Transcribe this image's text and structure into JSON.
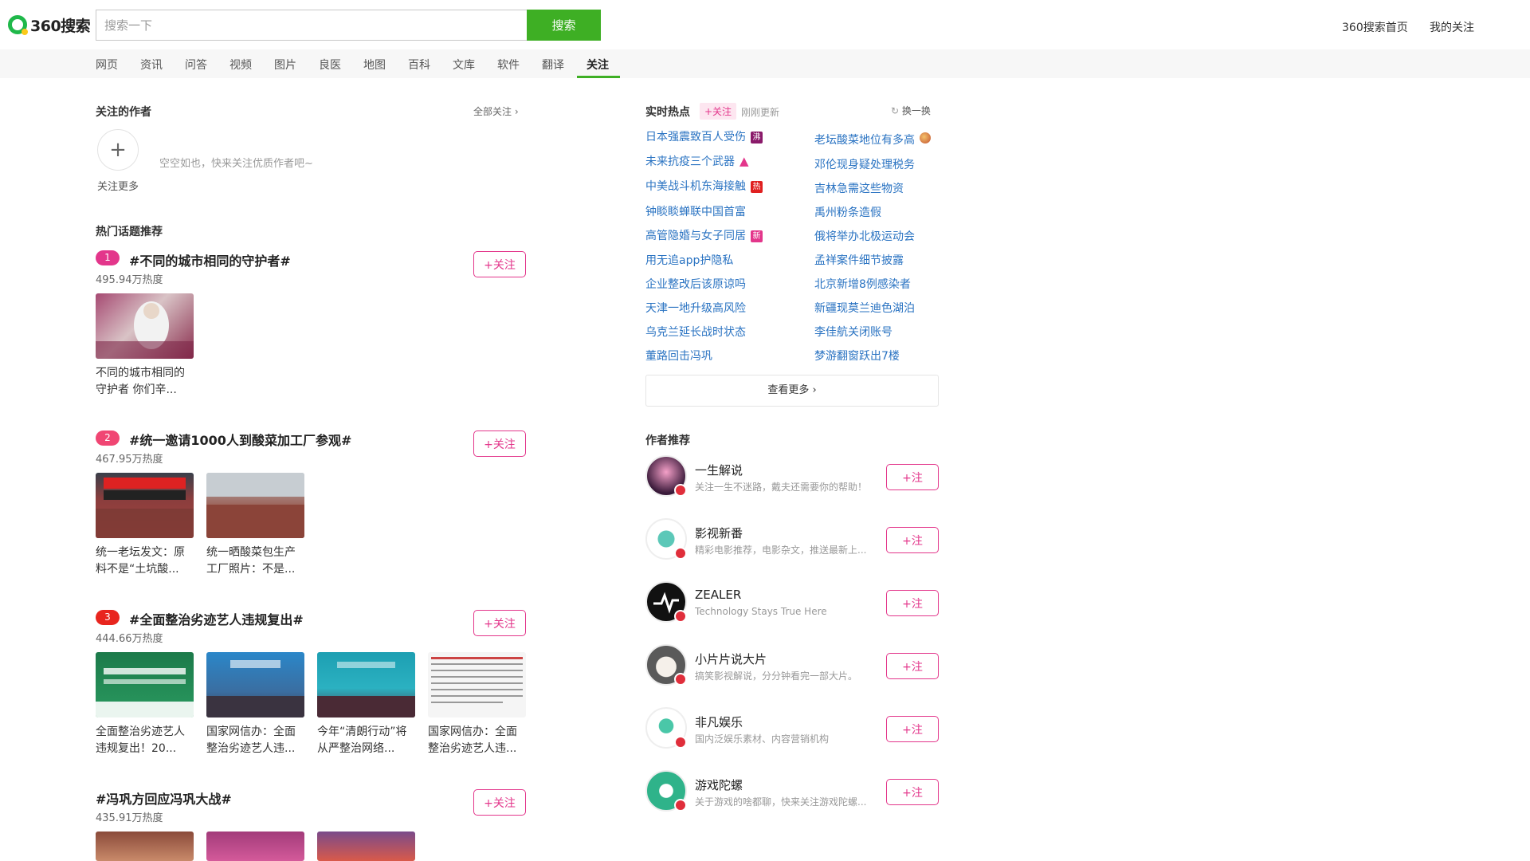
{
  "header": {
    "logo_text": "360搜索",
    "search_placeholder": "搜索一下",
    "search_button": "搜索",
    "links": [
      "360搜索首页",
      "我的关注"
    ]
  },
  "nav": {
    "items": [
      "网页",
      "资讯",
      "问答",
      "视频",
      "图片",
      "良医",
      "地图",
      "百科",
      "文库",
      "软件",
      "翻译",
      "关注"
    ],
    "active": "关注"
  },
  "followed_authors": {
    "title": "关注的作者",
    "all_link": "全部关注",
    "add_label": "关注更多",
    "add_symbol": "+",
    "empty_text": "空空如也，快来关注优质作者吧~"
  },
  "topics": {
    "title": "热门话题推荐",
    "follow_label": "+关注",
    "items": [
      {
        "rank": "1",
        "title": "#不同的城市相同的守护者#",
        "heat": "495.94万热度",
        "captions": [
          "不同的城市相同的守护者 你们辛..."
        ]
      },
      {
        "rank": "2",
        "title": "#统一邀请1000人到酸菜加工厂参观#",
        "heat": "467.95万热度",
        "captions": [
          "统一老坛发文：原料不是“土坑酸...",
          "统一晒酸菜包生产工厂照片：不是..."
        ]
      },
      {
        "rank": "3",
        "title": "#全面整治劣迹艺人违规复出#",
        "heat": "444.66万热度",
        "captions": [
          "全面整治劣迹艺人违规复出！20...",
          "国家网信办：全面整治劣迹艺人违...",
          "今年“清朗行动”将从严整治网络...",
          "国家网信办：全面整治劣迹艺人违..."
        ]
      },
      {
        "rank": "",
        "title": "#冯巩方回应冯巩大战#",
        "heat": "435.91万热度",
        "captions": []
      }
    ]
  },
  "hot": {
    "title": "实时热点",
    "tag": "+关注",
    "updated": "刚刚更新",
    "refresh": "换一换",
    "left": [
      {
        "text": "日本强震致百人受伤",
        "badge": "沸"
      },
      {
        "text": "未来抗疫三个武器",
        "badge": "up"
      },
      {
        "text": "中美战斗机东海接触",
        "badge": "热"
      },
      {
        "text": "钟睒睒蝉联中国首富",
        "badge": ""
      },
      {
        "text": "高管隐婚与女子同居",
        "badge": "新"
      },
      {
        "text": "用无追app护隐私",
        "badge": ""
      },
      {
        "text": "企业整改后该原谅吗",
        "badge": ""
      },
      {
        "text": "天津一地升级高风险",
        "badge": ""
      },
      {
        "text": "乌克兰延长战时状态",
        "badge": ""
      },
      {
        "text": "董路回击冯巩",
        "badge": ""
      }
    ],
    "right": [
      {
        "text": "老坛酸菜地位有多高",
        "badge": "img"
      },
      {
        "text": "邓伦现身疑处理税务",
        "badge": ""
      },
      {
        "text": "吉林急需这些物资",
        "badge": ""
      },
      {
        "text": "禹州粉条造假",
        "badge": ""
      },
      {
        "text": "俄将举办北极运动会",
        "badge": ""
      },
      {
        "text": "孟祥案件细节披露",
        "badge": ""
      },
      {
        "text": "北京新增8例感染者",
        "badge": ""
      },
      {
        "text": "新疆现莫兰迪色湖泊",
        "badge": ""
      },
      {
        "text": "李佳航关闭账号",
        "badge": ""
      },
      {
        "text": "梦游翻窗跃出7楼",
        "badge": ""
      }
    ],
    "see_more": "查看更多"
  },
  "authors": {
    "title": "作者推荐",
    "follow_label": "+注",
    "items": [
      {
        "name": "一生解说",
        "desc": "关注一生不迷路，戴夫还需要你的帮助！"
      },
      {
        "name": "影视新番",
        "desc": "精彩电影推荐，电影杂文，推送最新上..."
      },
      {
        "name": "ZEALER",
        "desc": "Technology Stays True Here"
      },
      {
        "name": "小片片说大片",
        "desc": "搞笑影视解说，分分钟看完一部大片。"
      },
      {
        "name": "非凡娱乐",
        "desc": "国内泛娱乐素材、内容营销机构"
      },
      {
        "name": "游戏陀螺",
        "desc": "关于游戏的啥都聊，快来关注游戏陀螺..."
      }
    ]
  },
  "colors": {
    "brand_green": "#3eaf24",
    "follow_pink": "#e3368b",
    "link_blue": "#2a73c2",
    "rank1": "#e3368b",
    "rank2": "#f04673",
    "rank3": "#e8251e"
  }
}
